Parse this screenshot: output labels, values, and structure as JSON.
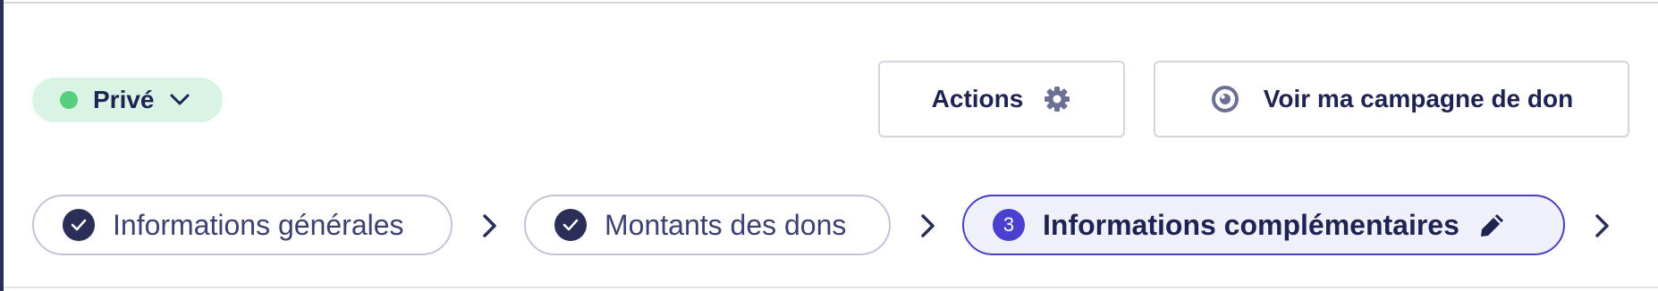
{
  "status": {
    "label": "Privé",
    "dot_color": "#56cf7e",
    "icon": "chevron-down-icon"
  },
  "toolbar": {
    "actions_label": "Actions",
    "actions_icon": "gear-icon",
    "view_label": "Voir ma campagne de don",
    "view_icon": "eye-icon"
  },
  "steps": [
    {
      "label": "Informations générales",
      "state": "completed",
      "icon": "check-icon"
    },
    {
      "label": "Montants des dons",
      "state": "completed",
      "icon": "check-icon"
    },
    {
      "number": "3",
      "label": "Informations complémentaires",
      "state": "current",
      "icon": "pencil-icon"
    }
  ],
  "colors": {
    "accent": "#4a3fbf",
    "text": "#1f2351"
  }
}
